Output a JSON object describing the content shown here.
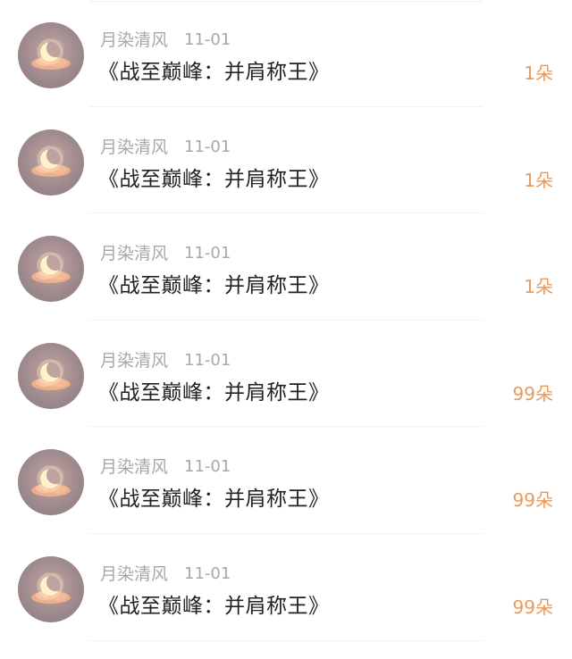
{
  "items": [
    {
      "username": "月染清风",
      "date": "11-01",
      "title": "《战至巅峰：并肩称王》",
      "amount": "1朵"
    },
    {
      "username": "月染清风",
      "date": "11-01",
      "title": "《战至巅峰：并肩称王》",
      "amount": "1朵"
    },
    {
      "username": "月染清风",
      "date": "11-01",
      "title": "《战至巅峰：并肩称王》",
      "amount": "1朵"
    },
    {
      "username": "月染清风",
      "date": "11-01",
      "title": "《战至巅峰：并肩称王》",
      "amount": "99朵"
    },
    {
      "username": "月染清风",
      "date": "11-01",
      "title": "《战至巅峰：并肩称王》",
      "amount": "99朵"
    },
    {
      "username": "月染清风",
      "date": "11-01",
      "title": "《战至巅峰：并肩称王》",
      "amount": "99朵"
    }
  ],
  "colors": {
    "meta_gray": "#a8a8a8",
    "title_dark": "#222222",
    "amount_orange": "#e89a5c",
    "divider": "#f2f2f2"
  },
  "icons": {
    "avatar": "moon-on-cloud-avatar"
  }
}
